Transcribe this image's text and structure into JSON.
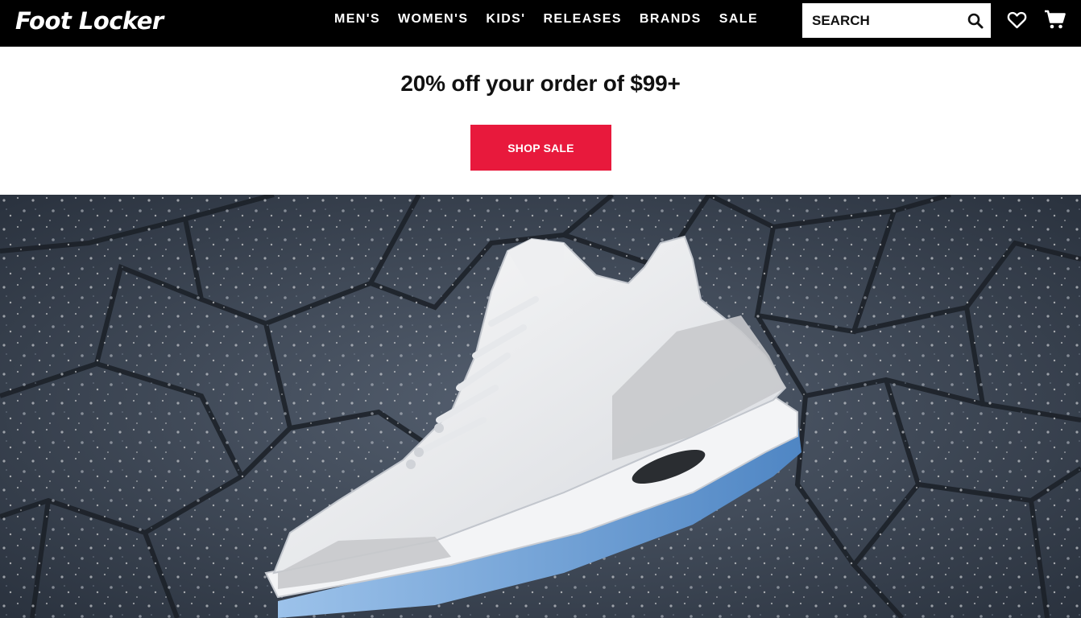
{
  "header": {
    "logo_text": "Foot Locker",
    "nav": [
      "MEN'S",
      "WOMEN'S",
      "KIDS'",
      "RELEASES",
      "BRANDS",
      "SALE"
    ],
    "search_placeholder": "SEARCH",
    "icons": [
      "search-icon",
      "heart-icon",
      "cart-icon"
    ]
  },
  "promo": {
    "headline": "20% off your order of $99+",
    "button_label": "SHOP SALE",
    "button_color": "#e8193c"
  },
  "hero": {
    "image": "white-sneaker-on-stone-wall"
  },
  "colors": {
    "header_bg": "#000000",
    "accent": "#e8193c"
  }
}
